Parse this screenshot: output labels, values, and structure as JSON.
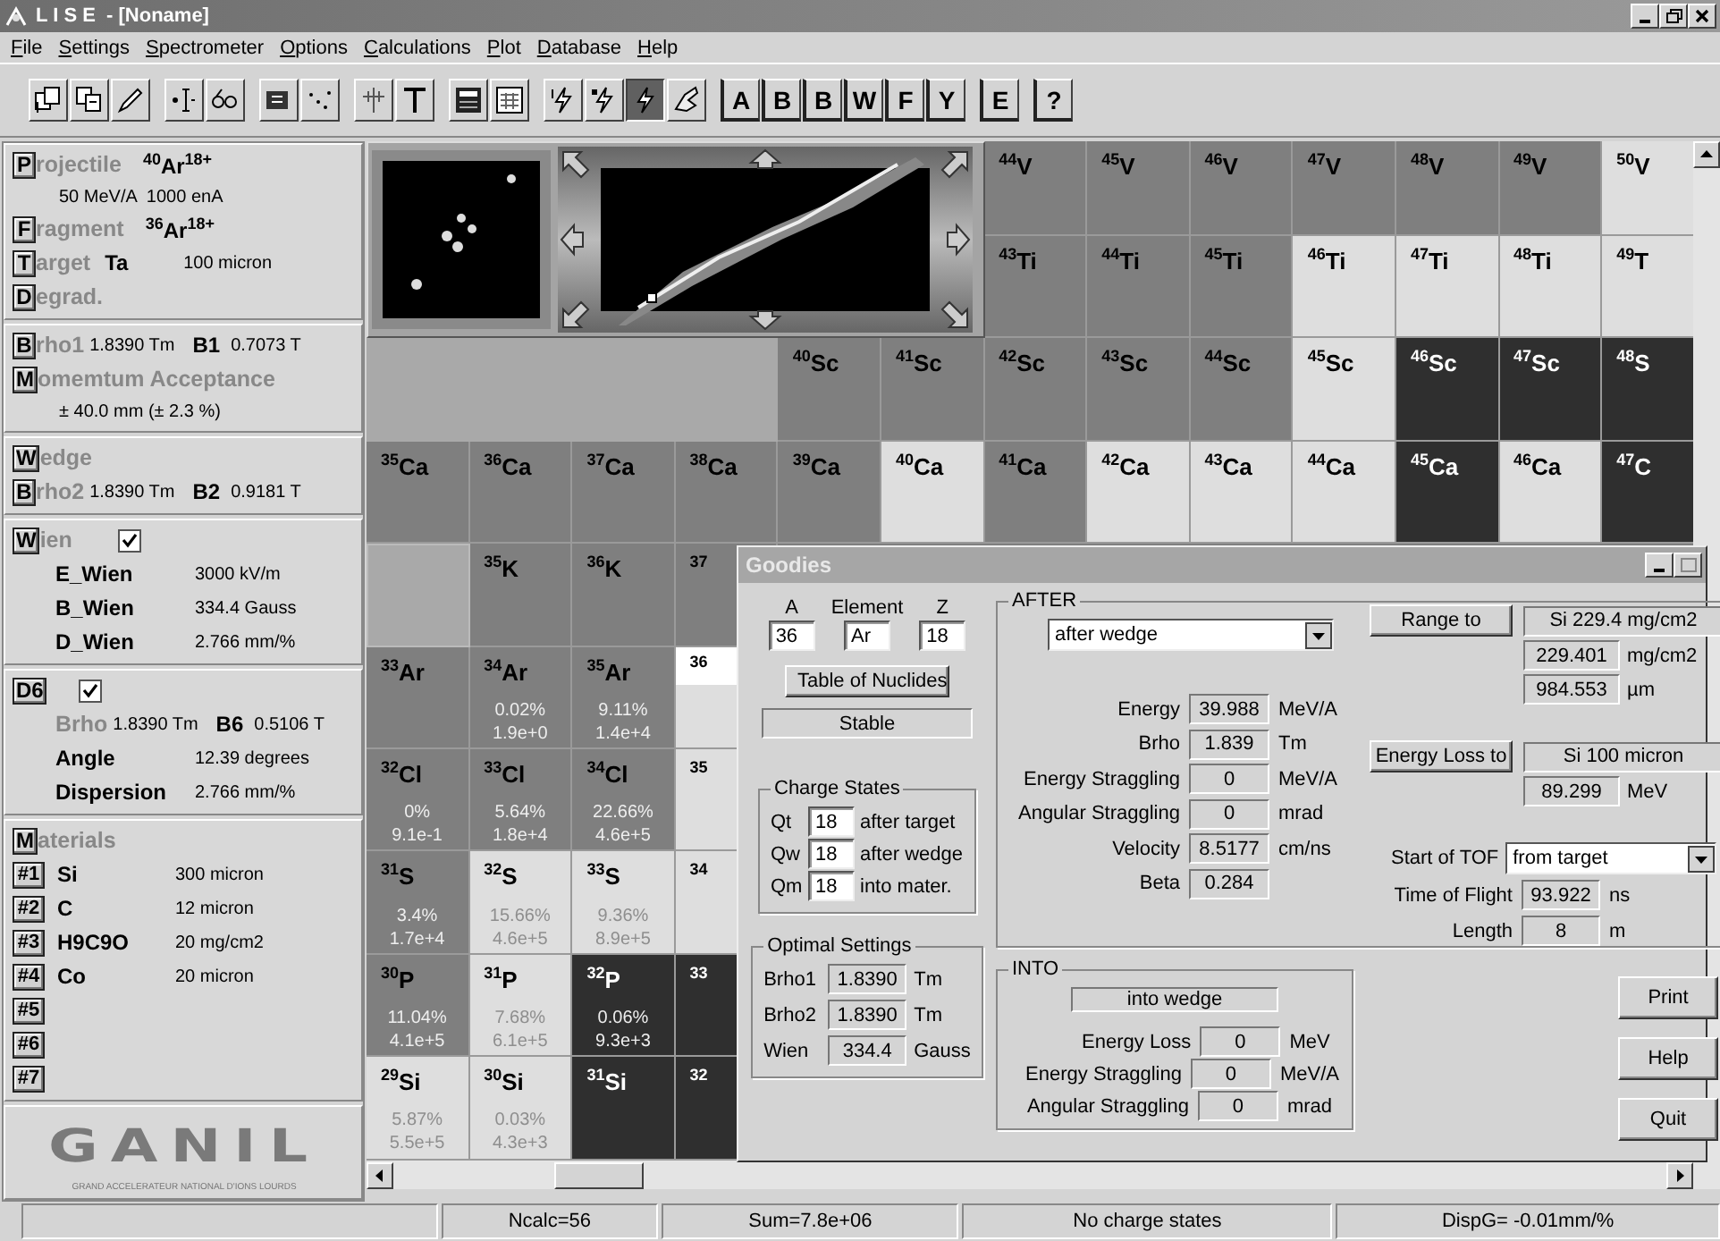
{
  "window": {
    "title": "L I S E  - [Noname]"
  },
  "menu": [
    "File",
    "Settings",
    "Spectrometer",
    "Options",
    "Calculations",
    "Plot",
    "Database",
    "Help"
  ],
  "toolbar": {
    "groups": [
      [
        {
          "kind": "icon",
          "pressed": false
        },
        {
          "kind": "icon",
          "pressed": false
        },
        {
          "kind": "icon",
          "pressed": false
        }
      ],
      [
        {
          "kind": "icon",
          "pressed": false
        },
        {
          "kind": "icon",
          "pressed": false
        }
      ],
      [
        {
          "kind": "icon",
          "pressed": false
        },
        {
          "kind": "icon",
          "pressed": false
        }
      ],
      [
        {
          "kind": "icon",
          "pressed": false
        },
        {
          "kind": "icon",
          "pressed": false
        }
      ],
      [
        {
          "kind": "icon",
          "pressed": false
        },
        {
          "kind": "icon",
          "pressed": false
        }
      ],
      [
        {
          "kind": "icon",
          "pressed": false
        },
        {
          "kind": "icon",
          "pressed": false
        },
        {
          "kind": "icon",
          "pressed": true
        },
        {
          "kind": "icon",
          "pressed": false
        }
      ],
      [
        {
          "kind": "glyph",
          "label": "A",
          "pressed": false
        },
        {
          "kind": "glyph",
          "label": "B",
          "pressed": false
        },
        {
          "kind": "glyph",
          "label": "B",
          "pressed": false
        },
        {
          "kind": "glyph",
          "label": "W",
          "pressed": false
        },
        {
          "kind": "glyph",
          "label": "F",
          "pressed": false
        },
        {
          "kind": "glyph",
          "label": "Y",
          "pressed": false
        }
      ],
      [
        {
          "kind": "glyph",
          "label": "E",
          "pressed": false
        }
      ],
      [
        {
          "kind": "glyph",
          "label": "?",
          "pressed": false
        }
      ]
    ]
  },
  "left_panel": {
    "sections": [
      {
        "rows": [
          {
            "kind": "head",
            "key": "P",
            "rest": "rojectile",
            "value": "$^{40}$Ar$^{18+}$"
          },
          {
            "kind": "note",
            "text": "50 MeV/A  1000 enA"
          },
          {
            "kind": "head",
            "key": "F",
            "rest": "ragment",
            "value": "$^{36}$Ar$^{18+}$"
          },
          {
            "kind": "target",
            "key": "T",
            "rest": "arget",
            "name": "Ta",
            "value": "100 micron"
          },
          {
            "kind": "head",
            "key": "D",
            "rest": "egrad."
          }
        ]
      },
      {
        "rows": [
          {
            "kind": "brho",
            "key": "B",
            "rest": "rho1",
            "brho": "1.8390 Tm",
            "b_label": "B1",
            "b_value": "0.7073 T"
          },
          {
            "kind": "head",
            "key": "M",
            "rest": "omemtum Acceptance"
          },
          {
            "kind": "note",
            "text": "± 40.0 mm (± 2.3 %)"
          }
        ]
      },
      {
        "rows": [
          {
            "kind": "head",
            "key": "W",
            "rest": "edge"
          },
          {
            "kind": "brho",
            "key": "B",
            "rest": "rho2",
            "brho": "1.8390 Tm",
            "b_label": "B2",
            "b_value": "0.9181 T"
          }
        ]
      },
      {
        "rows": [
          {
            "kind": "head",
            "key": "W",
            "rest": "ien",
            "checked": true
          },
          {
            "kind": "param",
            "label": "E_Wien",
            "value": "3000 kV/m"
          },
          {
            "kind": "param",
            "label": "B_Wien",
            "value": "334.4 Gauss"
          },
          {
            "kind": "param",
            "label": "D_Wien",
            "value": "2.766 mm/%"
          }
        ]
      },
      {
        "rows": [
          {
            "kind": "head",
            "key": "D6",
            "checked": true
          },
          {
            "kind": "brho",
            "rest": "Brho",
            "brho": "1.8390 Tm",
            "b_label": "B6",
            "b_value": "0.5106 T"
          },
          {
            "kind": "param",
            "label": "Angle",
            "value": "12.39 degrees"
          },
          {
            "kind": "param",
            "label": "Dispersion",
            "value": "2.766 mm/%"
          }
        ]
      },
      {
        "rows": [
          {
            "kind": "head",
            "key": "M",
            "rest": "aterials"
          },
          {
            "kind": "material",
            "key": "#1",
            "name": "Si",
            "value": "300 micron"
          },
          {
            "kind": "material",
            "key": "#2",
            "name": "C",
            "value": "12 micron"
          },
          {
            "kind": "material",
            "key": "#3",
            "name": "H9C9O",
            "value": "20 mg/cm2"
          },
          {
            "kind": "material",
            "key": "#4",
            "name": "Co",
            "value": "20 micron"
          },
          {
            "kind": "material",
            "key": "#5"
          },
          {
            "kind": "material",
            "key": "#6"
          },
          {
            "kind": "material",
            "key": "#7"
          }
        ]
      },
      {
        "rows": [
          {
            "kind": "logo",
            "text": "GANIL",
            "tagline": "GRAND ACCELERATEUR NATIONAL D'IONS LOURDS"
          }
        ]
      }
    ]
  },
  "chart": {
    "rows": [
      {
        "cells": [
          {
            "kind": "nuclide",
            "label": "$^{44}$V",
            "color": "#7f7f7f"
          },
          {
            "kind": "nuclide",
            "label": "$^{45}$V",
            "color": "#7f7f7f"
          },
          {
            "kind": "nuclide",
            "label": "$^{46}$V",
            "color": "#7f7f7f"
          },
          {
            "kind": "nuclide",
            "label": "$^{47}$V",
            "color": "#7f7f7f"
          },
          {
            "kind": "nuclide",
            "label": "$^{48}$V",
            "color": "#7f7f7f"
          },
          {
            "kind": "nuclide",
            "label": "$^{49}$V",
            "color": "#7f7f7f"
          },
          {
            "kind": "nuclide",
            "label": "$^{50}$V",
            "color": "#dedede"
          }
        ]
      },
      {
        "cells": [
          {
            "kind": "nuclide",
            "label": "$^{43}$Ti",
            "color": "#7f7f7f"
          },
          {
            "kind": "nuclide",
            "label": "$^{44}$Ti",
            "color": "#7f7f7f"
          },
          {
            "kind": "nuclide",
            "label": "$^{45}$Ti",
            "color": "#7f7f7f"
          },
          {
            "kind": "nuclide",
            "label": "$^{46}$Ti",
            "color": "#dedede"
          },
          {
            "kind": "nuclide",
            "label": "$^{47}$Ti",
            "color": "#dedede"
          },
          {
            "kind": "nuclide",
            "label": "$^{48}$Ti",
            "color": "#dedede"
          },
          {
            "kind": "nuclide",
            "label": "$^{49}$T",
            "color": "#dedede"
          }
        ]
      },
      {
        "cells": [
          {
            "kind": "blank",
            "color": "#a9a9a9"
          },
          {
            "kind": "blank",
            "color": "#a9a9a9"
          },
          {
            "kind": "blank",
            "color": "#a9a9a9"
          },
          {
            "kind": "blank",
            "color": "#a9a9a9"
          },
          {
            "kind": "nuclide",
            "label": "$^{40}$Sc",
            "color": "#7f7f7f"
          },
          {
            "kind": "nuclide",
            "label": "$^{41}$Sc",
            "color": "#7f7f7f"
          },
          {
            "kind": "nuclide",
            "label": "$^{42}$Sc",
            "color": "#7f7f7f"
          },
          {
            "kind": "nuclide",
            "label": "$^{43}$Sc",
            "color": "#7f7f7f"
          },
          {
            "kind": "nuclide",
            "label": "$^{44}$Sc",
            "color": "#7f7f7f"
          },
          {
            "kind": "nuclide",
            "label": "$^{45}$Sc",
            "color": "#dedede"
          },
          {
            "kind": "nuclide",
            "label": "$^{46}$Sc",
            "color": "#2f2f2f"
          },
          {
            "kind": "nuclide",
            "label": "$^{47}$Sc",
            "color": "#2f2f2f"
          },
          {
            "kind": "nuclide",
            "label": "$^{48}$S",
            "color": "#2f2f2f"
          }
        ]
      },
      {
        "cells": [
          {
            "kind": "nuclide",
            "label": "$^{35}$Ca",
            "color": "#7f7f7f"
          },
          {
            "kind": "nuclide",
            "label": "$^{36}$Ca",
            "color": "#7f7f7f"
          },
          {
            "kind": "nuclide",
            "label": "$^{37}$Ca",
            "color": "#7f7f7f"
          },
          {
            "kind": "nuclide",
            "label": "$^{38}$Ca",
            "color": "#7f7f7f"
          },
          {
            "kind": "nuclide",
            "label": "$^{39}$Ca",
            "color": "#7f7f7f"
          },
          {
            "kind": "nuclide",
            "label": "$^{40}$Ca",
            "color": "#dedede"
          },
          {
            "kind": "nuclide",
            "label": "$^{41}$Ca",
            "color": "#7f7f7f"
          },
          {
            "kind": "nuclide",
            "label": "$^{42}$Ca",
            "color": "#dedede"
          },
          {
            "kind": "nuclide",
            "label": "$^{43}$Ca",
            "color": "#dedede"
          },
          {
            "kind": "nuclide",
            "label": "$^{44}$Ca",
            "color": "#dedede"
          },
          {
            "kind": "nuclide",
            "label": "$^{45}$Ca",
            "color": "#2f2f2f"
          },
          {
            "kind": "nuclide",
            "label": "$^{46}$Ca",
            "color": "#dedede"
          },
          {
            "kind": "nuclide",
            "label": "$^{47}$C",
            "color": "#2f2f2f"
          }
        ]
      },
      {
        "cells": [
          {
            "kind": "blank",
            "color": "#a9a9a9"
          },
          {
            "kind": "nuclide",
            "label": "$^{35}$K",
            "color": "#7f7f7f"
          },
          {
            "kind": "nuclide",
            "label": "$^{36}$K",
            "color": "#7f7f7f"
          },
          {
            "kind": "nuclide",
            "label": "$^{37}$",
            "color": "#7f7f7f"
          }
        ]
      },
      {
        "cells": [
          {
            "kind": "nuclide",
            "label": "$^{33}$Ar",
            "color": "#7f7f7f"
          },
          {
            "kind": "nuclide",
            "label": "$^{34}$Ar",
            "color": "#7f7f7f",
            "values": [
              "0.02%",
              "1.9e+0"
            ]
          },
          {
            "kind": "nuclide",
            "label": "$^{35}$Ar",
            "color": "#7f7f7f",
            "values": [
              "9.11%",
              "1.4e+4"
            ]
          },
          {
            "kind": "fragment",
            "label": "$^{36}$",
            "color": "#dedede"
          }
        ]
      },
      {
        "cells": [
          {
            "kind": "nuclide",
            "label": "$^{32}$Cl",
            "color": "#7f7f7f",
            "values": [
              "0%",
              "9.1e-1"
            ]
          },
          {
            "kind": "nuclide",
            "label": "$^{33}$Cl",
            "color": "#7f7f7f",
            "values": [
              "5.64%",
              "1.8e+4"
            ]
          },
          {
            "kind": "nuclide",
            "label": "$^{34}$Cl",
            "color": "#7f7f7f",
            "values": [
              "22.66%",
              "4.6e+5"
            ]
          },
          {
            "kind": "nuclide",
            "label": "$^{35}$",
            "color": "#dedede"
          }
        ]
      },
      {
        "cells": [
          {
            "kind": "nuclide",
            "label": "$^{31}$S",
            "color": "#7f7f7f",
            "values": [
              "3.4%",
              "1.7e+4"
            ]
          },
          {
            "kind": "nuclide",
            "label": "$^{32}$S",
            "color": "#dedede",
            "values": [
              "15.66%",
              "4.6e+5"
            ]
          },
          {
            "kind": "nuclide",
            "label": "$^{33}$S",
            "color": "#dedede",
            "values": [
              "9.36%",
              "8.9e+5"
            ]
          },
          {
            "kind": "nuclide",
            "label": "$^{34}$",
            "color": "#dedede"
          }
        ]
      },
      {
        "cells": [
          {
            "kind": "nuclide",
            "label": "$^{30}$P",
            "color": "#7f7f7f",
            "values": [
              "11.04%",
              "4.1e+5"
            ]
          },
          {
            "kind": "nuclide",
            "label": "$^{31}$P",
            "color": "#dedede",
            "values": [
              "7.68%",
              "6.1e+5"
            ]
          },
          {
            "kind": "nuclide",
            "label": "$^{32}$P",
            "color": "#2f2f2f",
            "values": [
              "0.06%",
              "9.3e+3"
            ]
          },
          {
            "kind": "nuclide",
            "label": "$^{33}$",
            "color": "#2f2f2f"
          }
        ]
      },
      {
        "cells": [
          {
            "kind": "nuclide",
            "label": "$^{29}$Si",
            "color": "#dedede",
            "values": [
              "5.87%",
              "5.5e+5"
            ]
          },
          {
            "kind": "nuclide",
            "label": "$^{30}$Si",
            "color": "#dedede",
            "values": [
              "0.03%",
              "4.3e+3"
            ]
          },
          {
            "kind": "nuclide",
            "label": "$^{31}$Si",
            "color": "#2f2f2f"
          },
          {
            "kind": "nuclide",
            "label": "$^{32}$",
            "color": "#2f2f2f"
          }
        ]
      }
    ]
  },
  "goodies": {
    "title": "Goodies",
    "nuclide": {
      "labels": [
        "A",
        "Element",
        "Z"
      ],
      "values": [
        "36",
        "Ar",
        "18"
      ]
    },
    "table_button": "Table of Nuclides",
    "stability": "Stable",
    "charge_states": {
      "title": "Charge States",
      "rows": [
        {
          "label": "Qt",
          "value": "18",
          "note": "after target"
        },
        {
          "label": "Qw",
          "value": "18",
          "note": "after wedge"
        },
        {
          "label": "Qm",
          "value": "18",
          "note": "into mater."
        }
      ]
    },
    "optimal": {
      "title": "Optimal Settings",
      "rows": [
        {
          "label": "Brho1",
          "value": "1.8390",
          "unit": "Tm"
        },
        {
          "label": "Brho2",
          "value": "1.8390",
          "unit": "Tm"
        },
        {
          "label": "Wien",
          "value": "334.4",
          "unit": "Gauss"
        }
      ]
    },
    "after": {
      "title": "AFTER",
      "select": "after wedge",
      "rows": [
        {
          "label": "Energy",
          "value": "39.988",
          "unit": "MeV/A"
        },
        {
          "label": "Brho",
          "value": "1.839",
          "unit": "Tm"
        },
        {
          "label": "Energy Straggling",
          "value": "0",
          "unit": "MeV/A"
        },
        {
          "label": "Angular Straggling",
          "value": "0",
          "unit": "mrad"
        },
        {
          "label": "Velocity",
          "value": "8.5177",
          "unit": "cm/ns"
        },
        {
          "label": "Beta",
          "value": "0.284"
        }
      ],
      "range_button": "Range to",
      "range_target": "Si 229.4 mg/cm2",
      "range_rows": [
        {
          "value": "229.401",
          "unit": "mg/cm2"
        },
        {
          "value": "984.553",
          "unit": "µm"
        }
      ],
      "eloss_button": "Energy Loss to",
      "eloss_target": "Si 100 micron",
      "eloss_rows": [
        {
          "value": "89.299",
          "unit": "MeV"
        }
      ],
      "tof_label": "Start of TOF",
      "tof_select": "from target",
      "tof_rows": [
        {
          "label": "Time of Flight",
          "value": "93.922",
          "unit": "ns"
        },
        {
          "label": "Length",
          "value": "8",
          "unit": "m"
        }
      ]
    },
    "into": {
      "title": "INTO",
      "target": "into wedge",
      "rows": [
        {
          "label": "Energy Loss",
          "value": "0",
          "unit": "MeV"
        },
        {
          "label": "Energy Straggling",
          "value": "0",
          "unit": "MeV/A"
        },
        {
          "label": "Angular Straggling",
          "value": "0",
          "unit": "mrad"
        }
      ]
    },
    "buttons": [
      "Print",
      "Help",
      "Quit"
    ]
  },
  "status_bar": [
    "Ncalc=56",
    "Sum=7.8e+06",
    "No charge states",
    "DispG= -0.01mm/%"
  ]
}
